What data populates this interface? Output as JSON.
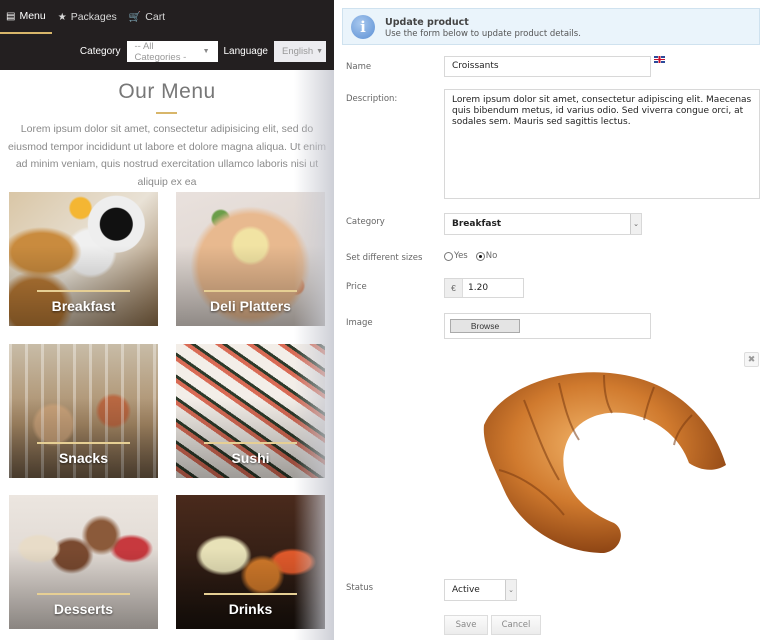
{
  "storefront": {
    "nav": [
      {
        "icon": "document-icon",
        "glyph": "🖹",
        "label": "Menu",
        "active": true
      },
      {
        "icon": "star-icon",
        "glyph": "★",
        "label": "Packages",
        "active": false
      },
      {
        "icon": "cart-icon",
        "glyph": "🛒",
        "label": "Cart",
        "active": false
      }
    ],
    "filters": {
      "category_label": "Category",
      "category_value": "-- All Categories -",
      "language_label": "Language",
      "language_value": "English"
    },
    "title": "Our Menu",
    "intro": "Lorem ipsum dolor sit amet, consectetur adipisicing elit, sed do eiusmod tempor incididunt ut labore et dolore magna aliqua. Ut enim ad minim veniam, quis nostrud exercitation ullamco laboris nisi ut aliquip ex ea",
    "categories": [
      "Breakfast",
      "Deli Platters",
      "Snacks",
      "Sushi",
      "Desserts",
      "Drinks"
    ],
    "accent_color": "#d8b66a"
  },
  "form": {
    "info": {
      "title": "Update product",
      "subtitle": "Use the form below to update product details."
    },
    "labels": {
      "name": "Name",
      "description": "Description:",
      "category": "Category",
      "sizes": "Set different sizes",
      "price": "Price",
      "image": "Image",
      "status": "Status"
    },
    "name": "Croissants",
    "description": "Lorem ipsum dolor sit amet, consectetur adipiscing elit. Maecenas quis bibendum metus, id varius odio. Sed viverra congue orci, at sodales sem. Mauris sed sagittis lectus.",
    "category": "Breakfast",
    "sizes": {
      "yes_label": "Yes",
      "no_label": "No",
      "selected": "No"
    },
    "currency": "€",
    "price": "1.20",
    "browse_label": "Browse",
    "remove_glyph": "✖",
    "status": "Active",
    "save_label": "Save",
    "cancel_label": "Cancel"
  }
}
